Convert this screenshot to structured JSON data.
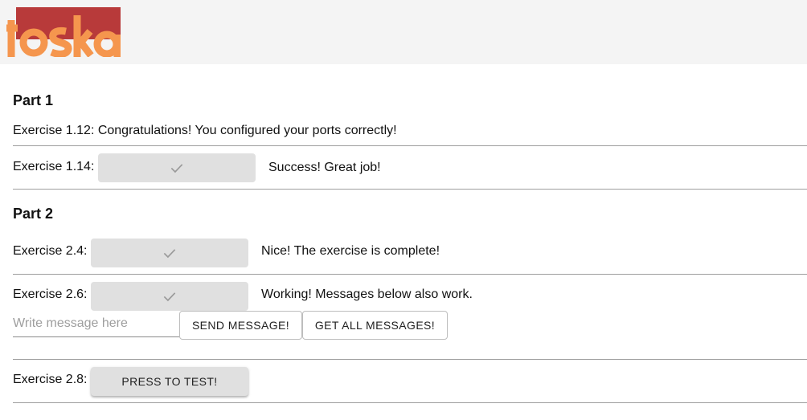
{
  "header": {
    "logo": {
      "text": "toska",
      "colors": {
        "red": "#b83a3a",
        "orange": "#f5964e"
      }
    }
  },
  "part1": {
    "heading": "Part 1",
    "ex112": {
      "text": "Exercise 1.12: Congratulations! You configured your ports correctly!"
    },
    "ex114": {
      "label": "Exercise 1.14:",
      "button_icon": "check-icon",
      "result": "Success! Great job!"
    }
  },
  "part2": {
    "heading": "Part 2",
    "ex24": {
      "label": "Exercise 2.4:",
      "button_icon": "check-icon",
      "result": "Nice! The exercise is complete!"
    },
    "ex26": {
      "label": "Exercise 2.6:",
      "button_icon": "check-icon",
      "result": "Working! Messages below also work.",
      "input_placeholder": "Write message here",
      "input_value": "",
      "send_label": "SEND MESSAGE!",
      "get_label": "GET ALL MESSAGES!"
    },
    "ex28": {
      "label": "Exercise 2.8:",
      "button_label": "PRESS TO TEST!"
    }
  },
  "colors": {
    "button_grey": "#e0e0e0",
    "divider": "#9e9e9e",
    "header_bg": "#f4f4f4"
  }
}
